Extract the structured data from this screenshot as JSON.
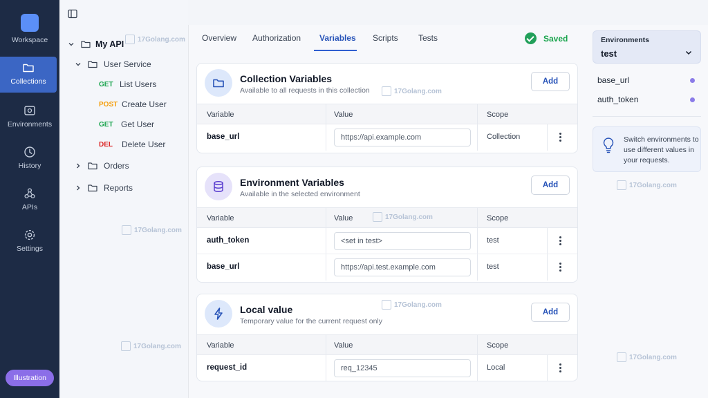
{
  "rail": {
    "items": [
      {
        "label": "Workspace",
        "icon": "workspace-logo-icon"
      },
      {
        "label": "Collections",
        "icon": "folder-icon",
        "active": true
      },
      {
        "label": "Environments",
        "icon": "environments-icon"
      },
      {
        "label": "History",
        "icon": "clock-icon"
      },
      {
        "label": "APIs",
        "icon": "apis-icon"
      },
      {
        "label": "Settings",
        "icon": "gear-icon"
      }
    ],
    "badge": "Illustration"
  },
  "tree": {
    "root": "My API",
    "folders": [
      {
        "name": "User Service",
        "expanded": true
      },
      {
        "name": "Orders",
        "expanded": false
      },
      {
        "name": "Reports",
        "expanded": false
      }
    ],
    "requests": [
      {
        "method": "GET",
        "name": "List Users"
      },
      {
        "method": "POST",
        "name": "Create User"
      },
      {
        "method": "GET",
        "name": "Get User"
      },
      {
        "method": "DEL",
        "name": "Delete User"
      }
    ]
  },
  "tabs": [
    "Overview",
    "Authorization",
    "Variables",
    "Scripts",
    "Tests"
  ],
  "active_tab": "Variables",
  "status": "Saved",
  "columns": {
    "variable": "Variable",
    "value": "Value",
    "scope": "Scope"
  },
  "cards": [
    {
      "title": "Collection Variables",
      "subtitle": "Available to all requests in this collection",
      "add": "Add",
      "rows": [
        {
          "variable": "base_url",
          "value": "https://api.example.com",
          "scope": "Collection"
        }
      ]
    },
    {
      "title": "Environment Variables",
      "subtitle": "Available in the selected environment",
      "add": "Add",
      "rows": [
        {
          "variable": "auth_token",
          "value": "<set in test>",
          "scope": "test"
        },
        {
          "variable": "base_url",
          "value": "https://api.test.example.com",
          "scope": "test"
        }
      ]
    },
    {
      "title": "Local value",
      "subtitle": "Temporary value for the current request only",
      "add": "Add",
      "rows": [
        {
          "variable": "request_id",
          "value": "req_12345",
          "scope": "Local"
        }
      ]
    }
  ],
  "environment": {
    "label": "Environments",
    "selected": "test",
    "variables": [
      "base_url",
      "auth_token"
    ],
    "tip": "Switch environments to use different values in your requests."
  },
  "watermark": "17Golang.com",
  "colors": {
    "rail": "#1d2b45",
    "rail_active": "#3b66c4",
    "accent": "#2f5fd0",
    "saved": "#16a34a",
    "get": "#16a34a",
    "post": "#f59e0b",
    "delete": "#dc2626",
    "env_dot": "#8b7ce8",
    "badge": "#8b6ee8"
  }
}
